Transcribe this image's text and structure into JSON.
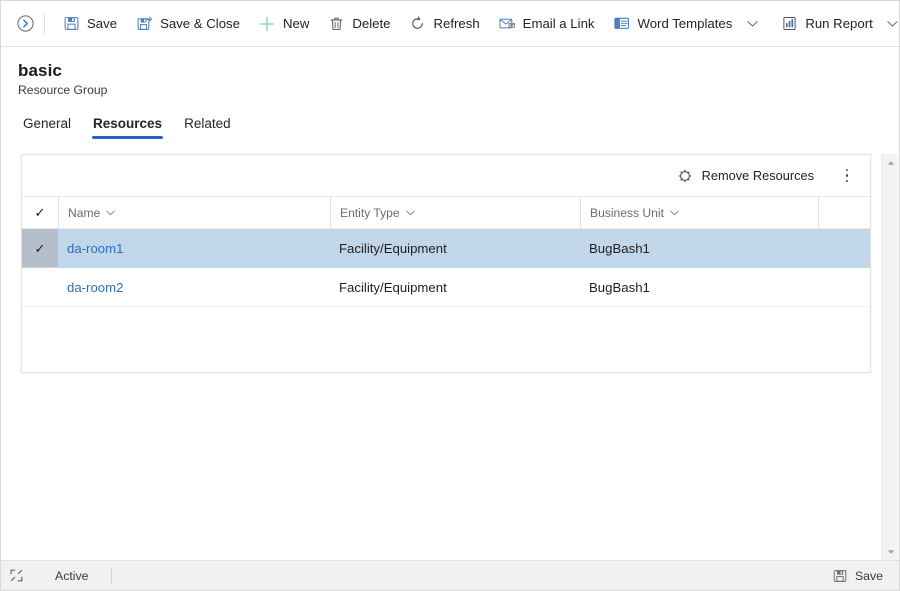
{
  "commandbar": {
    "expand_icon": "circle-chevron-right-icon",
    "buttons": [
      {
        "label": "Save",
        "icon": "save-disk-icon",
        "caret": false
      },
      {
        "label": "Save & Close",
        "icon": "save-and-close-icon",
        "caret": false
      },
      {
        "label": "New",
        "icon": "plus-icon",
        "caret": false
      },
      {
        "label": "Delete",
        "icon": "trash-icon",
        "caret": false
      },
      {
        "label": "Refresh",
        "icon": "refresh-icon",
        "caret": false
      },
      {
        "label": "Email a Link",
        "icon": "email-link-icon",
        "caret": false
      },
      {
        "label": "Word Templates",
        "icon": "word-template-icon",
        "caret": true
      },
      {
        "label": "Run Report",
        "icon": "report-icon",
        "caret": true
      }
    ]
  },
  "record": {
    "title": "basic",
    "subtitle": "Resource Group"
  },
  "tabs": [
    {
      "label": "General",
      "active": false
    },
    {
      "label": "Resources",
      "active": true
    },
    {
      "label": "Related",
      "active": false
    }
  ],
  "grid": {
    "toolbar": {
      "remove_label": "Remove Resources",
      "remove_icon": "remove-resource-icon",
      "overflow_icon": "more-vertical-icon"
    },
    "columns": [
      {
        "key": "check",
        "label": ""
      },
      {
        "key": "name",
        "label": "Name"
      },
      {
        "key": "entity_type",
        "label": "Entity Type"
      },
      {
        "key": "business_unit",
        "label": "Business Unit"
      }
    ],
    "rows": [
      {
        "selected": true,
        "name": "da-room1",
        "entity_type": "Facility/Equipment",
        "business_unit": "BugBash1"
      },
      {
        "selected": false,
        "name": "da-room2",
        "entity_type": "Facility/Equipment",
        "business_unit": "BugBash1"
      }
    ]
  },
  "statusbar": {
    "expand_icon": "expand-icon",
    "status": "Active",
    "save_label": "Save",
    "save_icon": "save-disk-icon"
  },
  "colors": {
    "accent": "#2266cc",
    "link": "#2c6fbb",
    "selected_row": "#c2d6ea",
    "new_icon_green": "#8cd6a5"
  }
}
